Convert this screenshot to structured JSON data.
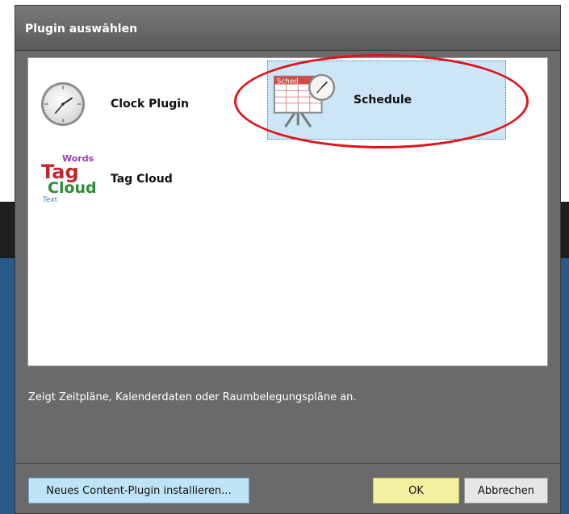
{
  "window": {
    "title": "Plugin auswählen"
  },
  "plugins": [
    {
      "label": "Clock Plugin",
      "icon": "clock-icon"
    },
    {
      "label": "Schedule",
      "icon": "schedule-icon",
      "selected": true
    },
    {
      "label": "Tag Cloud",
      "icon": "tag-cloud-icon"
    }
  ],
  "icon_text": {
    "schedule": "Sched",
    "tag_words": "Words",
    "tag_tag": "Tag",
    "tag_cloud": "Cloud",
    "tag_text": "Text"
  },
  "description": "Zeigt Zeitpläne, Kalenderdaten oder Raumbelegungspläne an.",
  "buttons": {
    "install": "Neues Content-Plugin installieren...",
    "ok": "OK",
    "cancel": "Abbrechen"
  },
  "colors": {
    "selection": "#cde6f7",
    "annotation": "#e0121b",
    "ok_button": "#f3f1a0",
    "install_button": "#bfe3f7"
  }
}
